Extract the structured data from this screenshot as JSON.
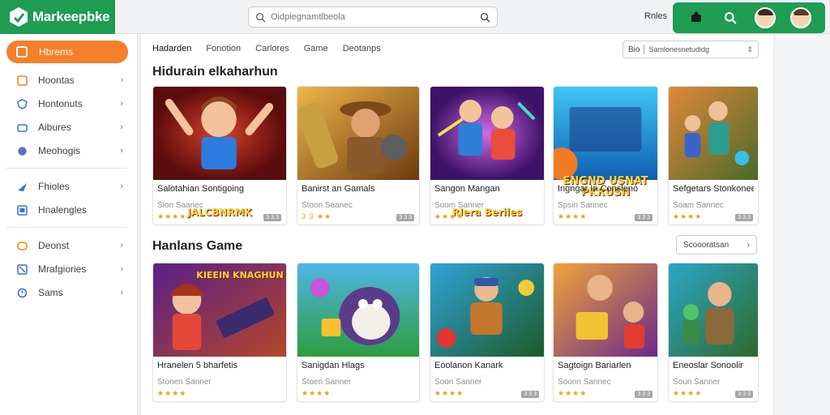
{
  "app": {
    "logo_text": "Markeepbke",
    "brand_color": "#1e9d53",
    "accent_color": "#f57f2a"
  },
  "search": {
    "placeholder": "Oidpiegnamtlbeola"
  },
  "header": {
    "help_label": "Rnles"
  },
  "sidebar": {
    "active": {
      "label": "Hbrems",
      "icon": "home-icon"
    },
    "items": [
      {
        "label": "Hoontas",
        "icon": "grid-icon"
      },
      {
        "label": "Hontonuts",
        "icon": "shield-icon"
      },
      {
        "label": "Aibures",
        "icon": "apps-icon"
      },
      {
        "label": "Meohogis",
        "icon": "globe-icon"
      },
      {
        "label": "Fhioles",
        "icon": "send-icon"
      },
      {
        "label": "Hnalengles",
        "icon": "calendar-icon"
      },
      {
        "label": "Deonst",
        "icon": "circle-icon"
      },
      {
        "label": "Mrafgiories",
        "icon": "image-icon"
      },
      {
        "label": "Sams",
        "icon": "clock-icon"
      }
    ]
  },
  "tabs": [
    "Hadarden",
    "Fonotion",
    "Carlores",
    "Game",
    "Deotanps"
  ],
  "filter": {
    "label": "Bio",
    "value": "Samlonesnetudidg"
  },
  "sections": [
    {
      "title": "Hidurain elkaharhun",
      "cards": [
        {
          "title": "Salotahian Sontigoing",
          "sub": "Sion Saanec",
          "rating": "★★★★",
          "banner": "JALCBNRMK",
          "badge": "3 3 3"
        },
        {
          "title": "Banirst an Gamals",
          "sub": "Stoon Saanec",
          "rating": "3 3 ★★",
          "banner": "",
          "badge": "3 3 3"
        },
        {
          "title": "Sangon Mangan",
          "sub": "Soom Sanner",
          "rating": "★★★★",
          "banner": "Rlera Beriles",
          "badge": ""
        },
        {
          "title": "Ingngar In Consleno",
          "sub": "Spsin Sannec",
          "rating": "★★★★",
          "banner": "ENGND USNAT PKRUSN",
          "badge": "3 3 3"
        },
        {
          "title": "Sefgetars Stonkonee",
          "sub": "Soam Sannec",
          "rating": "★★★★",
          "banner": "",
          "badge": "3 3 3"
        }
      ]
    },
    {
      "title": "Hanlans Game",
      "button": "Scoooratsan",
      "cards": [
        {
          "title": "Hranelen 5 bharfetis",
          "sub": "Stonen Sanner",
          "rating": "★★★★",
          "banner": "KIEEIN KNAGHUN",
          "badge": ""
        },
        {
          "title": "Sanigdan Hlags",
          "sub": "Stoen Sanner",
          "rating": "★★★★",
          "banner": "",
          "badge": ""
        },
        {
          "title": "Eoolanon Kanark",
          "sub": "Soon Sanner",
          "rating": "★★★★",
          "banner": "",
          "badge": "3 3 3"
        },
        {
          "title": "Sagtoign Bariarlen",
          "sub": "Soonn Sannec",
          "rating": "★★★★",
          "banner": "",
          "badge": "3 3 3"
        },
        {
          "title": "Eneoslar Sonoolir",
          "sub": "Soun Sanner",
          "rating": "★★★★",
          "banner": "",
          "badge": "3 3 3"
        }
      ]
    }
  ]
}
